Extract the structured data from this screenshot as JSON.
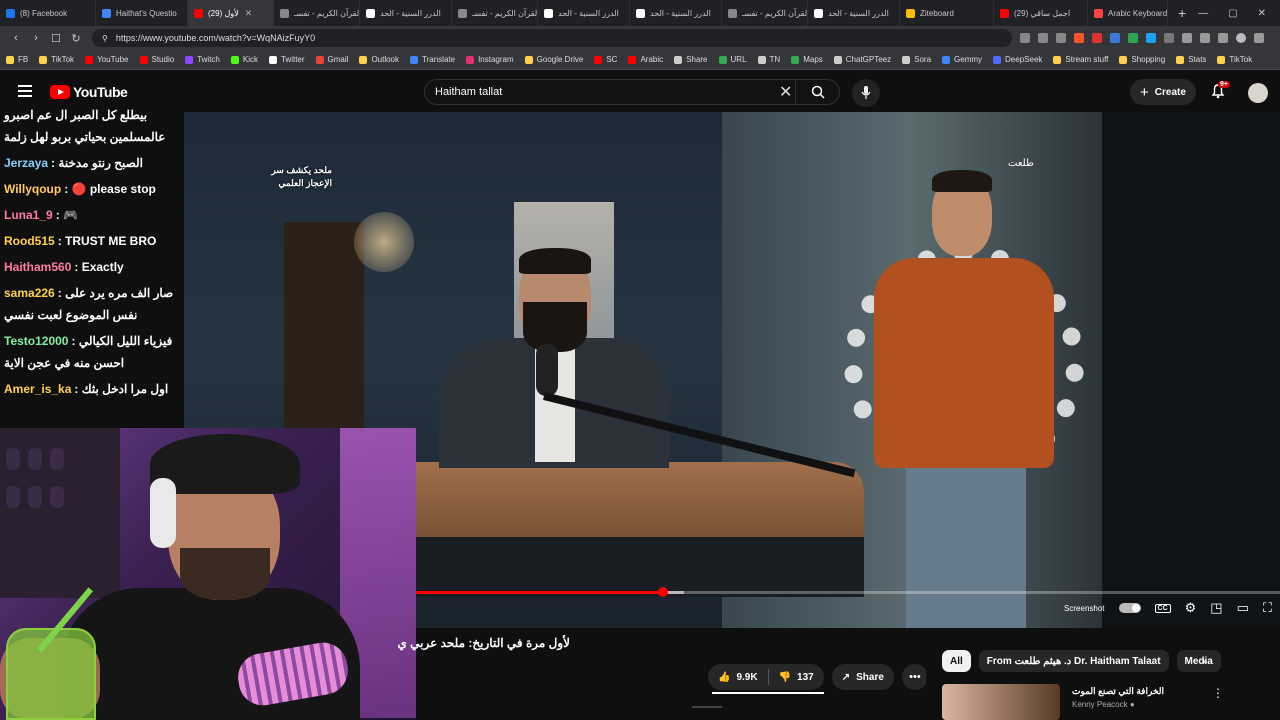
{
  "browser": {
    "tabs": [
      {
        "label": "(8) Facebook",
        "color": "#1877f2"
      },
      {
        "label": "Haithat's Questio",
        "color": "#4285f4"
      },
      {
        "label": "(29) لأول",
        "color": "#ff0000",
        "active": true,
        "close": "✕"
      },
      {
        "label": "القرآن الكريم - تفسـ",
        "color": "#888888"
      },
      {
        "label": "الدرر السنية - الحد",
        "color": "#ffffff"
      },
      {
        "label": "القرآن الكريم - تفسـ",
        "color": "#888888"
      },
      {
        "label": "الدرر السنية - الحد",
        "color": "#ffffff"
      },
      {
        "label": "الدرر السنية - الحد",
        "color": "#ffffff"
      },
      {
        "label": "القرآن الكريم - تفسـ",
        "color": "#888888"
      },
      {
        "label": "الدرر السنية - الحد",
        "color": "#ffffff"
      },
      {
        "label": "Ziteboard",
        "color": "#fbbc04"
      },
      {
        "label": "(29) اجمل ساقي",
        "color": "#ff0000"
      },
      {
        "label": "Arabic Keyboard",
        "color": "#ff4444"
      }
    ],
    "new_tab": "+",
    "window_controls": [
      "—",
      "▢",
      "✕"
    ],
    "url": "https://www.youtube.com/watch?v=WqNAizFuyY0",
    "bookmarks": [
      {
        "label": "FB",
        "color": "#ffd04d"
      },
      {
        "label": "TikTok",
        "color": "#ffd04d"
      },
      {
        "label": "YouTube",
        "color": "#ff0000"
      },
      {
        "label": "Studio",
        "color": "#ff0000"
      },
      {
        "label": "Twitch",
        "color": "#9146ff"
      },
      {
        "label": "Kick",
        "color": "#53fc18"
      },
      {
        "label": "Twitter",
        "color": "#ffffff"
      },
      {
        "label": "Gmail",
        "color": "#ea4335"
      },
      {
        "label": "Outlook",
        "color": "#ffd04d"
      },
      {
        "label": "Translate",
        "color": "#4285f4"
      },
      {
        "label": "Instagram",
        "color": "#e1306c"
      },
      {
        "label": "Google Drive",
        "color": "#ffd04d"
      },
      {
        "label": "SC",
        "color": "#ff0000"
      },
      {
        "label": "Arabic",
        "color": "#ff0000"
      },
      {
        "label": "Share",
        "color": "#cccccc"
      },
      {
        "label": "URL",
        "color": "#34a853"
      },
      {
        "label": "TN",
        "color": "#cccccc"
      },
      {
        "label": "Maps",
        "color": "#34a853"
      },
      {
        "label": "ChatGPTeez",
        "color": "#cccccc"
      },
      {
        "label": "Sora",
        "color": "#cccccc"
      },
      {
        "label": "Gemmy",
        "color": "#4285f4"
      },
      {
        "label": "DeepSeek",
        "color": "#4d6bfe"
      },
      {
        "label": "Stream stuff",
        "color": "#ffd04d"
      },
      {
        "label": "Shopping",
        "color": "#ffd04d"
      },
      {
        "label": "Stats",
        "color": "#ffd04d"
      },
      {
        "label": "TikTok",
        "color": "#ffd04d"
      }
    ]
  },
  "youtube": {
    "logo_text": "YouTube",
    "search_query": "Haitham tallat",
    "create_label": "Create",
    "notif_count": "9+"
  },
  "video": {
    "overlay_text": "ملحد يكشف سر الإعجاز العلمي",
    "brand_text": "طلعت",
    "progress": 0.286,
    "buffered": 0.31,
    "screenshot_label": "Screenshot",
    "cc_label": "CC"
  },
  "chat": [
    {
      "user": "",
      "text": "بيطلع كل الصبر ال عم اصبرو عالمسلمين بحياتي بربو لهل زلمة",
      "color": "#ffffff"
    },
    {
      "user": "Jerzaya",
      "text": ": الصبح رنتو مدخنة",
      "color": "#7fd3ff"
    },
    {
      "user": "Willyqoup",
      "text": ": 🔴 please stop",
      "color": "#ffcc66"
    },
    {
      "user": "Luna1_9",
      "text": ": 🎮",
      "color": "#ff7aa8"
    },
    {
      "user": "Rood515",
      "text": ": TRUST ME BRO",
      "color": "#ffd24d"
    },
    {
      "user": "Haitham560",
      "text": ": Exactly",
      "color": "#ff7aa8"
    },
    {
      "user": "sama226",
      "text": ": صار الف مره يرد على نفس الموضوع لعبت نفسي",
      "color": "#ffd24d"
    },
    {
      "user": "Testo12000",
      "text": ": فيزياء الليل الكيالي احسن منه في عجن الاية",
      "color": "#7ff0a0"
    },
    {
      "user": "Amer_is_ka",
      "text": ": اول مرا ادخل بثك",
      "color": "#ffd24d"
    }
  ],
  "details": {
    "title": "لأول مرة في التاريخ: ملحد عربي ي",
    "likes": "9.9K",
    "dislikes": "137",
    "share": "Share",
    "more": "•••"
  },
  "sidebar": {
    "chips": [
      "All",
      "From د. هيثم طلعت Dr. Haitham Talaat",
      "Media"
    ],
    "next": "›",
    "rec_title": "الخرافة التي تصنع الموت",
    "rec_channel": "Kenny Peacock ●",
    "rec_menu": "⋮"
  }
}
